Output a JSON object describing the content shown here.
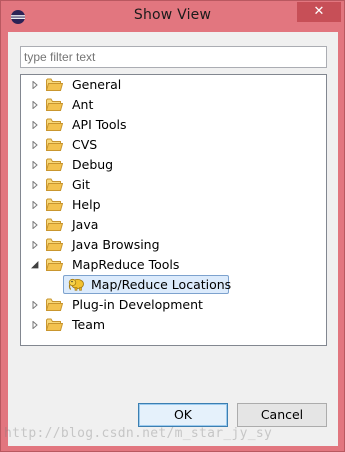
{
  "window": {
    "title": "Show View",
    "close_symbol": "✕",
    "app_icon": "eclipse-icon"
  },
  "filter": {
    "placeholder": "type filter text"
  },
  "tree": {
    "items": [
      {
        "label": "General",
        "expanded": false
      },
      {
        "label": "Ant",
        "expanded": false
      },
      {
        "label": "API Tools",
        "expanded": false
      },
      {
        "label": "CVS",
        "expanded": false
      },
      {
        "label": "Debug",
        "expanded": false
      },
      {
        "label": "Git",
        "expanded": false
      },
      {
        "label": "Help",
        "expanded": false
      },
      {
        "label": "Java",
        "expanded": false
      },
      {
        "label": "Java Browsing",
        "expanded": false
      },
      {
        "label": "MapReduce Tools",
        "expanded": true
      },
      {
        "label": "Map/Reduce Locations",
        "child": true,
        "selected": true,
        "icon": "elephant-icon"
      },
      {
        "label": "Plug-in Development",
        "expanded": false
      },
      {
        "label": "Team",
        "expanded": false
      }
    ]
  },
  "buttons": {
    "ok": "OK",
    "cancel": "Cancel"
  },
  "watermark": "http://blog.csdn.net/m_star_jy_sy",
  "colors": {
    "title_bar": "#e2767f",
    "close_button": "#c74f57",
    "selection": "#dcebfc",
    "folder": "#e9c25e"
  }
}
